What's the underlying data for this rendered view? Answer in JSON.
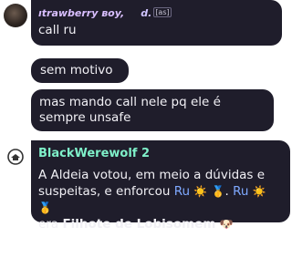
{
  "messages": [
    {
      "sender": "ıtrawberry ʙoy,",
      "sender_suffix": "d.",
      "tag": "[as]",
      "text": "call ru"
    },
    {
      "text": "sem motivo"
    },
    {
      "text": "mas mando call nele pq ele é sempre unsafe"
    }
  ],
  "bot_message": {
    "sender": "BlackWerewolf 2",
    "text_prefix": "A Aldeia votou, em meio a dúvidas e suspeitas, e enforcou",
    "mention1": "Ru",
    "emoji_sun": "☀️",
    "emoji_medal": "🥇",
    "dot": ".",
    "mention2": "Ru",
    "text_mid": "era",
    "role": "Filhote de Lobisomem",
    "emoji_pup": "🐶"
  },
  "colors": {
    "bubble": "#1f1d2b",
    "text": "#f1f0f5",
    "bot_name": "#7ff0c9",
    "mention": "#7fa9ff",
    "sender_name": "#d9bfff"
  },
  "icons": {
    "avatar": "user-avatar",
    "bot": "bot-icon"
  }
}
